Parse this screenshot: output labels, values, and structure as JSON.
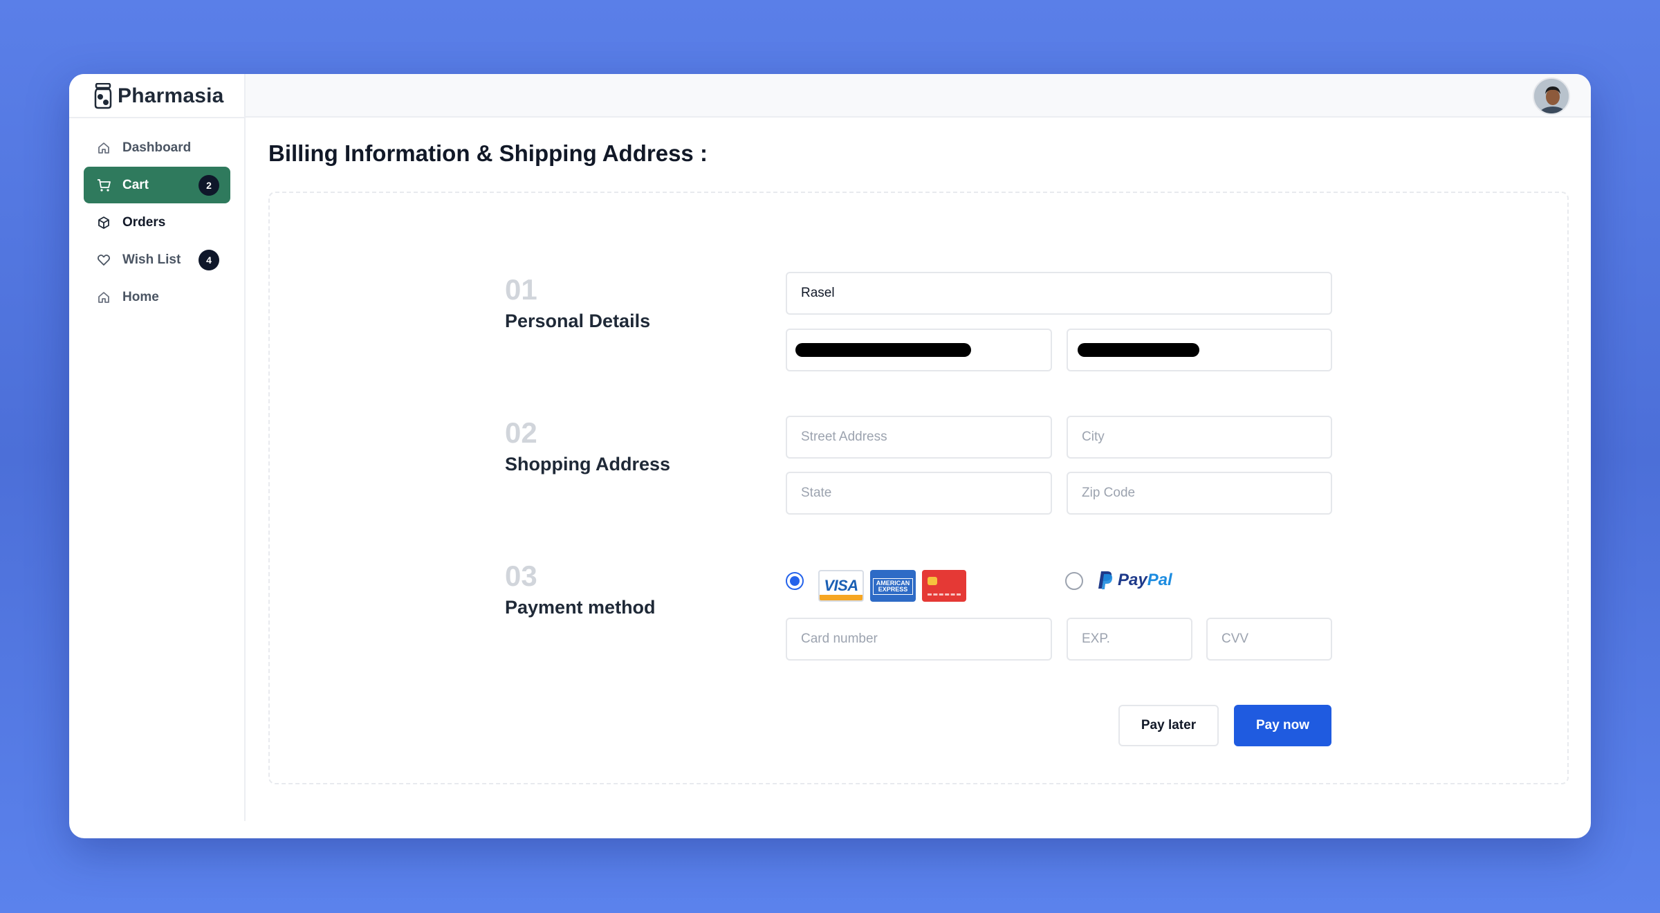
{
  "app": {
    "name": "Pharmasia"
  },
  "sidebar": {
    "items": [
      {
        "label": "Dashboard",
        "icon": "home-icon",
        "active": false
      },
      {
        "label": "Cart",
        "icon": "cart-icon",
        "active": true,
        "badge": "2"
      },
      {
        "label": "Orders",
        "icon": "box-icon",
        "active": false
      },
      {
        "label": "Wish List",
        "icon": "heart-icon",
        "active": false,
        "badge": "4"
      },
      {
        "label": "Home",
        "icon": "home-icon",
        "active": false
      }
    ]
  },
  "header": {
    "avatar_icon": "user-avatar"
  },
  "page": {
    "title": "Billing Information & Shipping Address :"
  },
  "form": {
    "personal": {
      "number": "01",
      "title": "Personal Details",
      "name_value": "Rasel"
    },
    "address": {
      "number": "02",
      "title": "Shopping Address",
      "street_placeholder": "Street Address",
      "city_placeholder": "City",
      "state_placeholder": "State",
      "zip_placeholder": "Zip Code"
    },
    "payment": {
      "number": "03",
      "title": "Payment method",
      "card_option_selected": true,
      "paypal_option_selected": false,
      "visa_label": "VISA",
      "amex_label": "AMERICAN EXPRESS",
      "paypal_label_1": "Pay",
      "paypal_label_2": "Pal",
      "card_number_placeholder": "Card number",
      "exp_placeholder": "EXP.",
      "cvv_placeholder": "CVV"
    },
    "actions": {
      "pay_later": "Pay later",
      "pay_now": "Pay now"
    }
  },
  "colors": {
    "background": "#5a7fe8",
    "sidebar_active": "#2f7a5d",
    "primary_button": "#1f5be0",
    "badge": "#0f172a"
  }
}
